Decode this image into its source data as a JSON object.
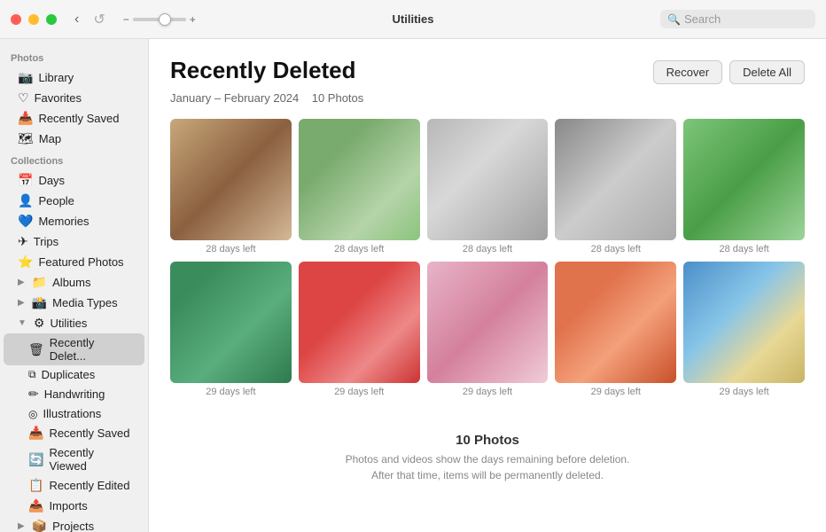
{
  "titlebar": {
    "title": "Utilities",
    "search_placeholder": "Search",
    "nav_back": "‹",
    "slider_min": "−",
    "slider_max": "+"
  },
  "sidebar": {
    "section_photos": "Photos",
    "section_collections": "Collections",
    "items_photos": [
      {
        "id": "library",
        "label": "Library",
        "icon": "📷"
      },
      {
        "id": "favorites",
        "label": "Favorites",
        "icon": "♡"
      },
      {
        "id": "recently-saved",
        "label": "Recently Saved",
        "icon": "📥"
      },
      {
        "id": "map",
        "label": "Map",
        "icon": "🗺"
      }
    ],
    "items_collections": [
      {
        "id": "days",
        "label": "Days",
        "icon": "📅"
      },
      {
        "id": "people",
        "label": "People",
        "icon": "👤"
      },
      {
        "id": "memories",
        "label": "Memories",
        "icon": "💙"
      },
      {
        "id": "trips",
        "label": "Trips",
        "icon": "✈"
      },
      {
        "id": "featured-photos",
        "label": "Featured Photos",
        "icon": "⭐"
      },
      {
        "id": "albums",
        "label": "Albums",
        "icon": "📁",
        "expandable": true
      },
      {
        "id": "media-types",
        "label": "Media Types",
        "icon": "📸",
        "expandable": true
      },
      {
        "id": "utilities",
        "label": "Utilities",
        "icon": "⚙",
        "expanded": true
      }
    ],
    "utilities_sub": [
      {
        "id": "recently-deleted",
        "label": "Recently Delet...",
        "icon": "🗑",
        "active": true
      },
      {
        "id": "duplicates",
        "label": "Duplicates",
        "icon": "⧉"
      },
      {
        "id": "handwriting",
        "label": "Handwriting",
        "icon": "✏"
      },
      {
        "id": "illustrations",
        "label": "Illustrations",
        "icon": "🖼"
      },
      {
        "id": "recently-saved-sub",
        "label": "Recently Saved",
        "icon": "📥"
      },
      {
        "id": "recently-viewed",
        "label": "Recently Viewed",
        "icon": "🔄"
      },
      {
        "id": "recently-edited",
        "label": "Recently Edited",
        "icon": "📋"
      },
      {
        "id": "imports",
        "label": "Imports",
        "icon": "📤"
      }
    ],
    "projects": {
      "label": "Projects",
      "icon": "📦",
      "expandable": true
    }
  },
  "content": {
    "title": "Recently Deleted",
    "subtitle_date": "January – February 2024",
    "subtitle_count": "10 Photos",
    "btn_recover": "Recover",
    "btn_delete_all": "Delete All",
    "footer_count": "10 Photos",
    "footer_line1": "Photos and videos show the days remaining before deletion.",
    "footer_line2": "After that time, items will be permanently deleted.",
    "photos": [
      {
        "id": "dog1",
        "days": "28 days left",
        "color_class": "photo-dog1"
      },
      {
        "id": "dog2",
        "days": "28 days left",
        "color_class": "photo-dog2"
      },
      {
        "id": "dog3",
        "days": "28 days left",
        "color_class": "photo-dog3"
      },
      {
        "id": "girl1",
        "days": "28 days left",
        "color_class": "photo-girl1"
      },
      {
        "id": "girl2",
        "days": "28 days left",
        "color_class": "photo-girl2"
      },
      {
        "id": "fruit1",
        "days": "29 days left",
        "color_class": "photo-fruit1"
      },
      {
        "id": "fruit2",
        "days": "29 days left",
        "color_class": "photo-fruit2"
      },
      {
        "id": "cake",
        "days": "29 days left",
        "color_class": "photo-cake"
      },
      {
        "id": "fruit3",
        "days": "29 days left",
        "color_class": "photo-fruit3"
      },
      {
        "id": "beach",
        "days": "29 days left",
        "color_class": "photo-beach"
      }
    ]
  }
}
